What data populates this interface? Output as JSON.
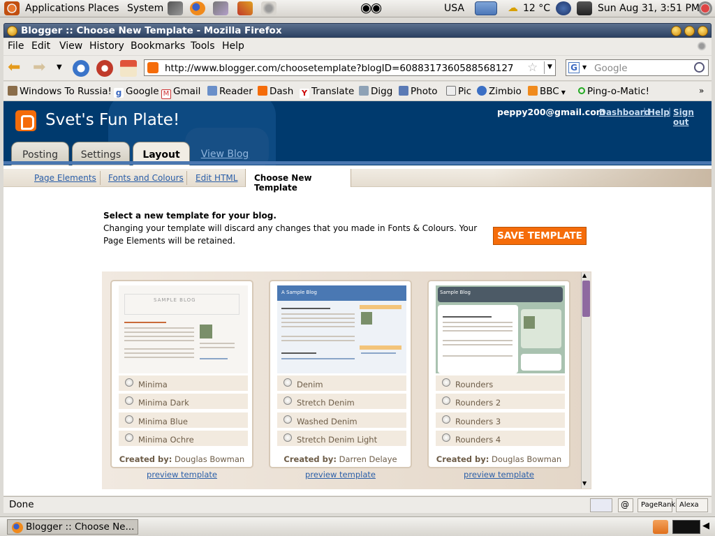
{
  "top_panel": {
    "menus": [
      "Applications",
      "Places",
      "System"
    ],
    "locale": "USA",
    "weather": "12 °C",
    "clock": "Sun Aug 31,  3:51 PM"
  },
  "window": {
    "title": "Blogger :: Choose New Template - Mozilla Firefox"
  },
  "menubar": [
    "File",
    "Edit",
    "View",
    "History",
    "Bookmarks",
    "Tools",
    "Help"
  ],
  "navbar": {
    "url": "http://www.blogger.com/choosetemplate?blogID=6088317360588568127",
    "search_placeholder": "Google"
  },
  "bookmarks": [
    "Windows To Russia!",
    "Google",
    "Gmail",
    "Reader",
    "Dash",
    "Translate",
    "Digg",
    "Photo",
    "Pic",
    "Zimbio",
    "BBC",
    "Ping-o-Matic!"
  ],
  "blogger": {
    "blog_title": "Svet's Fun Plate!",
    "email": "peppy200@gmail.com",
    "links": [
      "Dashboard",
      "Help",
      "Sign out"
    ],
    "tabs": [
      "Posting",
      "Settings",
      "Layout",
      "View Blog"
    ],
    "active_tab": "Layout",
    "subnav": [
      "Page Elements",
      "Fonts and Colours",
      "Edit HTML",
      "Choose New Template"
    ],
    "intro_title": "Select a new template for your blog.",
    "intro_text": "Changing your template will discard any changes that you made in Fonts & Colours. Your Page Elements will be retained.",
    "save_button": "SAVE TEMPLATE"
  },
  "templates": [
    {
      "thumb_title": "SAMPLE BLOG",
      "options": [
        "Minima",
        "Minima Dark",
        "Minima Blue",
        "Minima Ochre"
      ],
      "created_by_label": "Created by:",
      "author": "Douglas Bowman",
      "preview": "preview template"
    },
    {
      "thumb_title": "A Sample Blog",
      "options": [
        "Denim",
        "Stretch Denim",
        "Washed Denim",
        "Stretch Denim Light"
      ],
      "created_by_label": "Created by:",
      "author": "Darren Delaye",
      "preview": "preview template"
    },
    {
      "thumb_title": "Sample Blog",
      "options": [
        "Rounders",
        "Rounders 2",
        "Rounders 3",
        "Rounders 4"
      ],
      "created_by_label": "Created by:",
      "author": "Douglas Bowman",
      "preview": "preview template"
    }
  ],
  "statusbar": {
    "status": "Done",
    "pagerank": "PageRank",
    "alexa": "Alexa"
  },
  "taskbar": {
    "task": "Blogger :: Choose Ne..."
  },
  "colors": {
    "blogger_orange": "#f56c0a",
    "header_navy": "#003a6e",
    "link_blue": "#2a5ea8"
  }
}
